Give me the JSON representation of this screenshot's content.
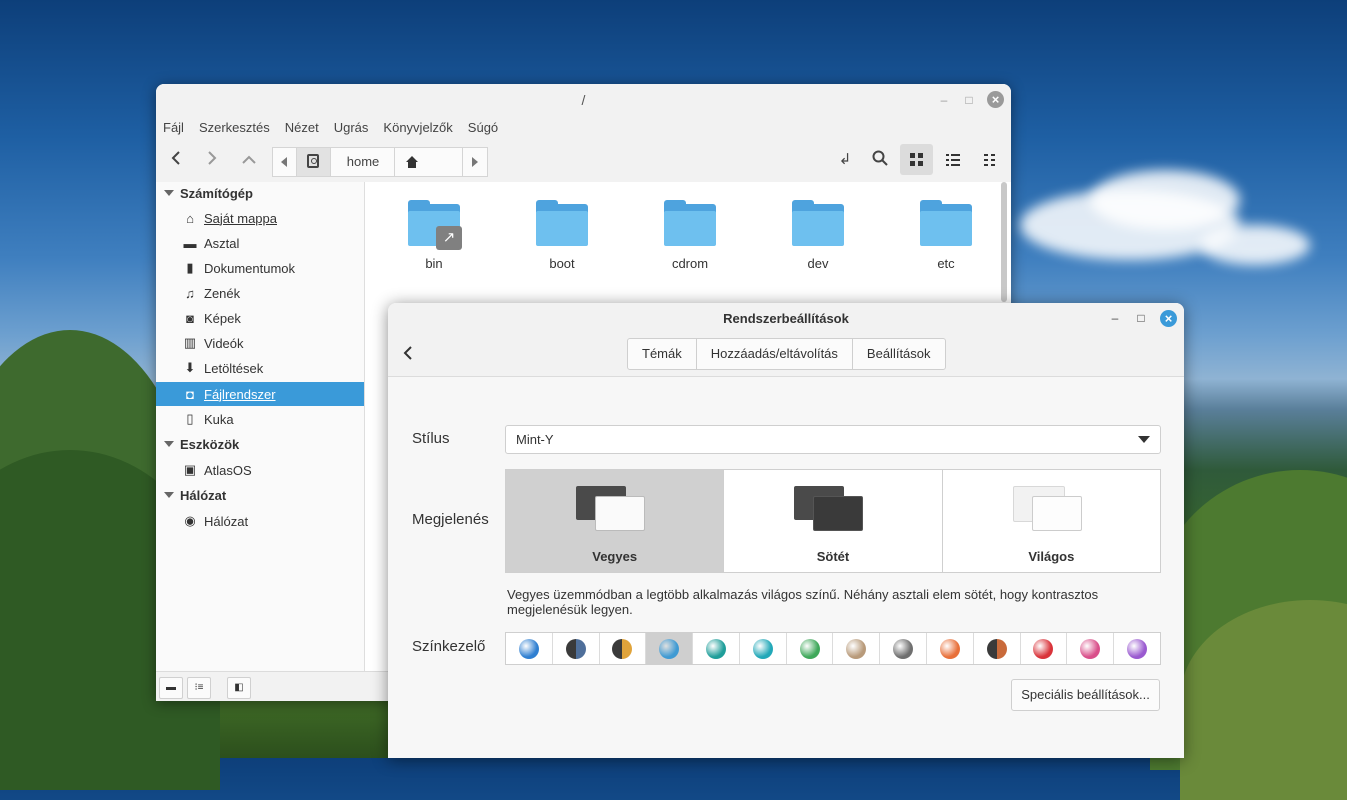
{
  "file_manager": {
    "title": "/",
    "menu": [
      "Fájl",
      "Szerkesztés",
      "Nézet",
      "Ugrás",
      "Könyvjelzők",
      "Súgó"
    ],
    "breadcrumb": {
      "current": "home"
    },
    "sidebar": {
      "sections": [
        {
          "label": "Számítógép",
          "items": [
            "Saját mappa",
            "Asztal",
            "Dokumentumok",
            "Zenék",
            "Képek",
            "Videók",
            "Letöltések",
            "Fájlrendszer",
            "Kuka"
          ]
        },
        {
          "label": "Eszközök",
          "items": [
            "AtlasOS"
          ]
        },
        {
          "label": "Hálózat",
          "items": [
            "Hálózat"
          ]
        }
      ],
      "active_item": "Fájlrendszer"
    },
    "folders": [
      "bin",
      "boot",
      "cdrom",
      "dev",
      "etc"
    ]
  },
  "settings": {
    "title": "Rendszerbeállítások",
    "tabs": [
      "Témák",
      "Hozzáadás/eltávolítás",
      "Beállítások"
    ],
    "style_label": "Stílus",
    "style_value": "Mint-Y",
    "appearance_label": "Megjelenés",
    "modes": [
      {
        "label": "Vegyes",
        "selected": true
      },
      {
        "label": "Sötét",
        "selected": false
      },
      {
        "label": "Világos",
        "selected": false
      }
    ],
    "description": "Vegyes üzemmódban a legtöbb alkalmazás világos színű. Néhány asztali elem sötét, hogy kontrasztos megjelenésük legyen.",
    "accent_label": "Színkezelő",
    "accent_colors": [
      "#2f7fd1",
      "#4f6f9a",
      "#e0a33a",
      "#3f9ad3",
      "#1f9e9a",
      "#22a8b8",
      "#3fa85a",
      "#b89a7a",
      "#6f6f6f",
      "#e8703a",
      "#c96a3a",
      "#d9333a",
      "#d94f8a",
      "#9a5ad0"
    ],
    "accent_selected_index": 3,
    "advanced_button": "Speciális beállítások..."
  }
}
